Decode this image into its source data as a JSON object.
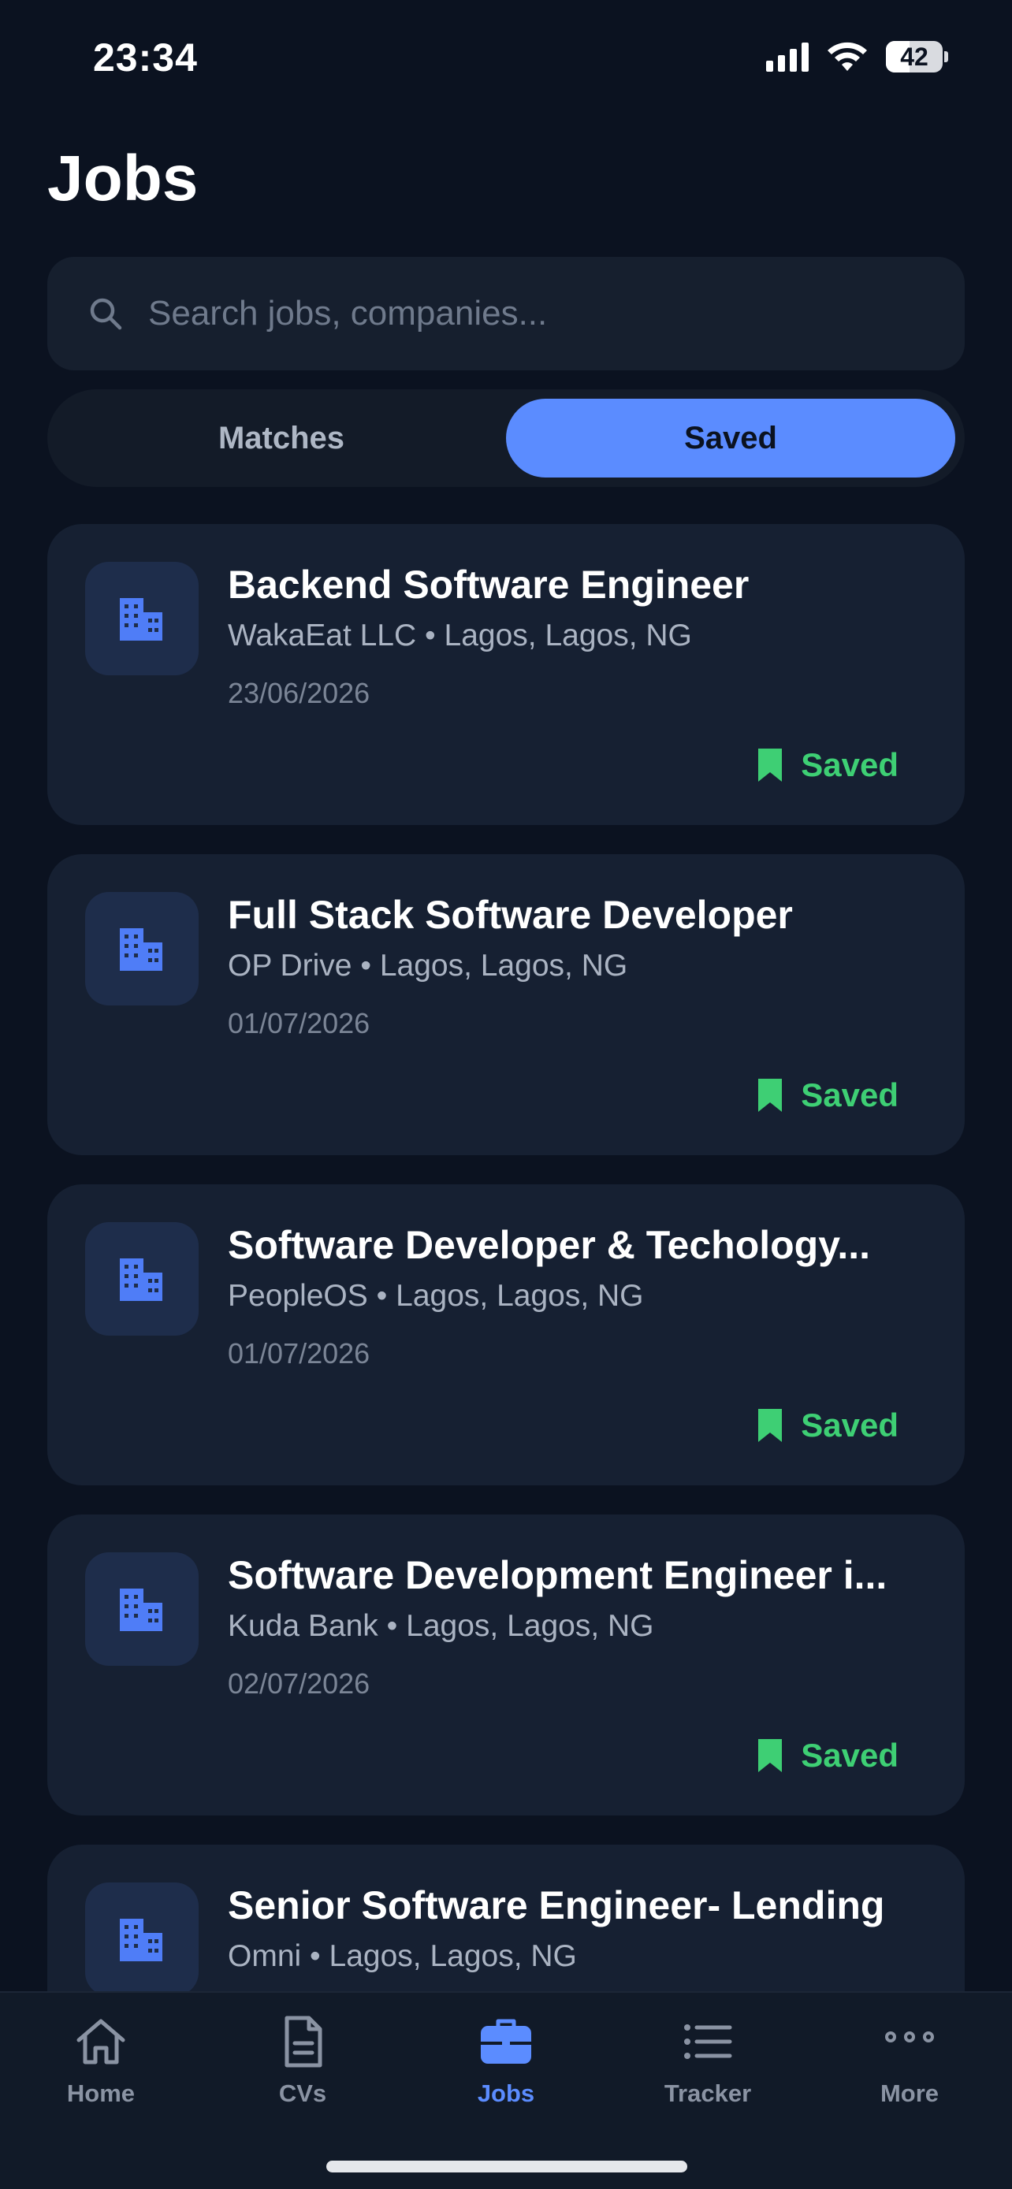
{
  "status_bar": {
    "time": "23:34",
    "battery": "42",
    "battery_level": 0.42
  },
  "page": {
    "title": "Jobs"
  },
  "search": {
    "placeholder": "Search jobs, companies..."
  },
  "segments": [
    {
      "label": "Matches",
      "active": false
    },
    {
      "label": "Saved",
      "active": true
    }
  ],
  "jobs": [
    {
      "title": "Backend Software Engineer",
      "company": "WakaEat LLC",
      "location": "Lagos, Lagos, NG",
      "date": "23/06/2026",
      "status": "Saved"
    },
    {
      "title": "Full Stack Software Developer",
      "company": "OP Drive",
      "location": "Lagos, Lagos, NG",
      "date": "01/07/2026",
      "status": "Saved"
    },
    {
      "title": "Software Developer & Techology...",
      "company": "PeopleOS",
      "location": "Lagos, Lagos, NG",
      "date": "01/07/2026",
      "status": "Saved"
    },
    {
      "title": "Software Development Engineer i...",
      "company": "Kuda Bank",
      "location": "Lagos, Lagos, NG",
      "date": "02/07/2026",
      "status": "Saved"
    },
    {
      "title": "Senior Software Engineer- Lending",
      "company": "Omni",
      "location": "Lagos, Lagos, NG",
      "date": "",
      "status": ""
    }
  ],
  "meta_separator": "•",
  "tabs": [
    {
      "label": "Home",
      "icon": "home-icon",
      "active": false
    },
    {
      "label": "CVs",
      "icon": "document-icon",
      "active": false
    },
    {
      "label": "Jobs",
      "icon": "briefcase-icon",
      "active": true
    },
    {
      "label": "Tracker",
      "icon": "list-icon",
      "active": false
    },
    {
      "label": "More",
      "icon": "more-icon",
      "active": false
    }
  ],
  "colors": {
    "background": "#0b1220",
    "card": "#162032",
    "accent": "#5b8cff",
    "saved_green": "#3ecf74"
  }
}
